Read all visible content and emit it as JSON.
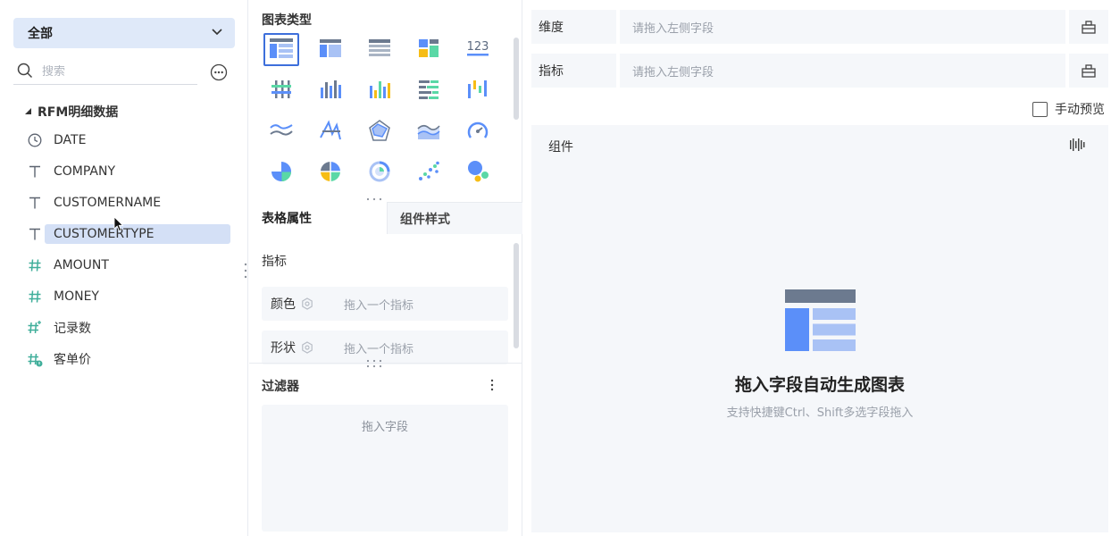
{
  "left_panel": {
    "scope_select": {
      "value": "全部"
    },
    "search": {
      "placeholder": "搜索"
    },
    "dataset": {
      "name": "RFM明细数据"
    },
    "fields": [
      {
        "name": "DATE",
        "icon": "clock-icon",
        "type": "date"
      },
      {
        "name": "COMPANY",
        "icon": "text-icon",
        "type": "text"
      },
      {
        "name": "CUSTOMERNAME",
        "icon": "text-icon",
        "type": "text"
      },
      {
        "name": "CUSTOMERTYPE",
        "icon": "text-icon",
        "type": "text",
        "selected": true
      },
      {
        "name": "AMOUNT",
        "icon": "number-icon",
        "type": "number"
      },
      {
        "name": "MONEY",
        "icon": "number-icon",
        "type": "number"
      },
      {
        "name": "记录数",
        "icon": "calculated-number-icon",
        "type": "calculated"
      },
      {
        "name": "客单价",
        "icon": "calculated-number-icon",
        "type": "calculated"
      }
    ]
  },
  "chart_panel": {
    "title": "图表类型",
    "chart_types": [
      "table-icon",
      "cross-table-icon",
      "detail-table-icon",
      "kpi-card-icon",
      "number-card-icon",
      "grouped-bar-icon",
      "column-chart-icon",
      "multi-column-icon",
      "horizontal-bar-icon",
      "waterfall-icon",
      "line-chart-icon",
      "radar-line-icon",
      "radar-chart-icon",
      "area-chart-icon",
      "gauge-icon",
      "pie-chart-icon",
      "rose-pie-icon",
      "ring-chart-icon",
      "scatter-chart-icon",
      "bubble-chart-icon"
    ],
    "selected_chart_type_index": 0,
    "tabs": [
      {
        "label": "表格属性",
        "active": true
      },
      {
        "label": "组件样式",
        "active": false
      }
    ],
    "metric_label": "指标",
    "properties": [
      {
        "label": "颜色",
        "placeholder": "拖入一个指标"
      },
      {
        "label": "形状",
        "placeholder": "拖入一个指标"
      }
    ],
    "filter": {
      "title": "过滤器",
      "placeholder": "拖入字段"
    }
  },
  "config_panel": {
    "dimension": {
      "label": "维度",
      "placeholder": "请拖入左侧字段"
    },
    "metric": {
      "label": "指标",
      "placeholder": "请拖入左侧字段"
    },
    "manual_preview": {
      "label": "手动预览",
      "checked": false
    },
    "canvas": {
      "title": "组件",
      "empty_title": "拖入字段自动生成图表",
      "empty_subtitle": "支持快捷键Ctrl、Shift多选字段拖入"
    }
  },
  "colors": {
    "accent": "#3d6fdb",
    "select_bg": "#dfe9f9",
    "selected_field_bg": "#d4e0f6",
    "panel_bg": "#f5f7fa",
    "chart_blue": "#5b8ff9",
    "chart_teal": "#5ad8a6",
    "chart_yellow": "#f6bd16"
  }
}
